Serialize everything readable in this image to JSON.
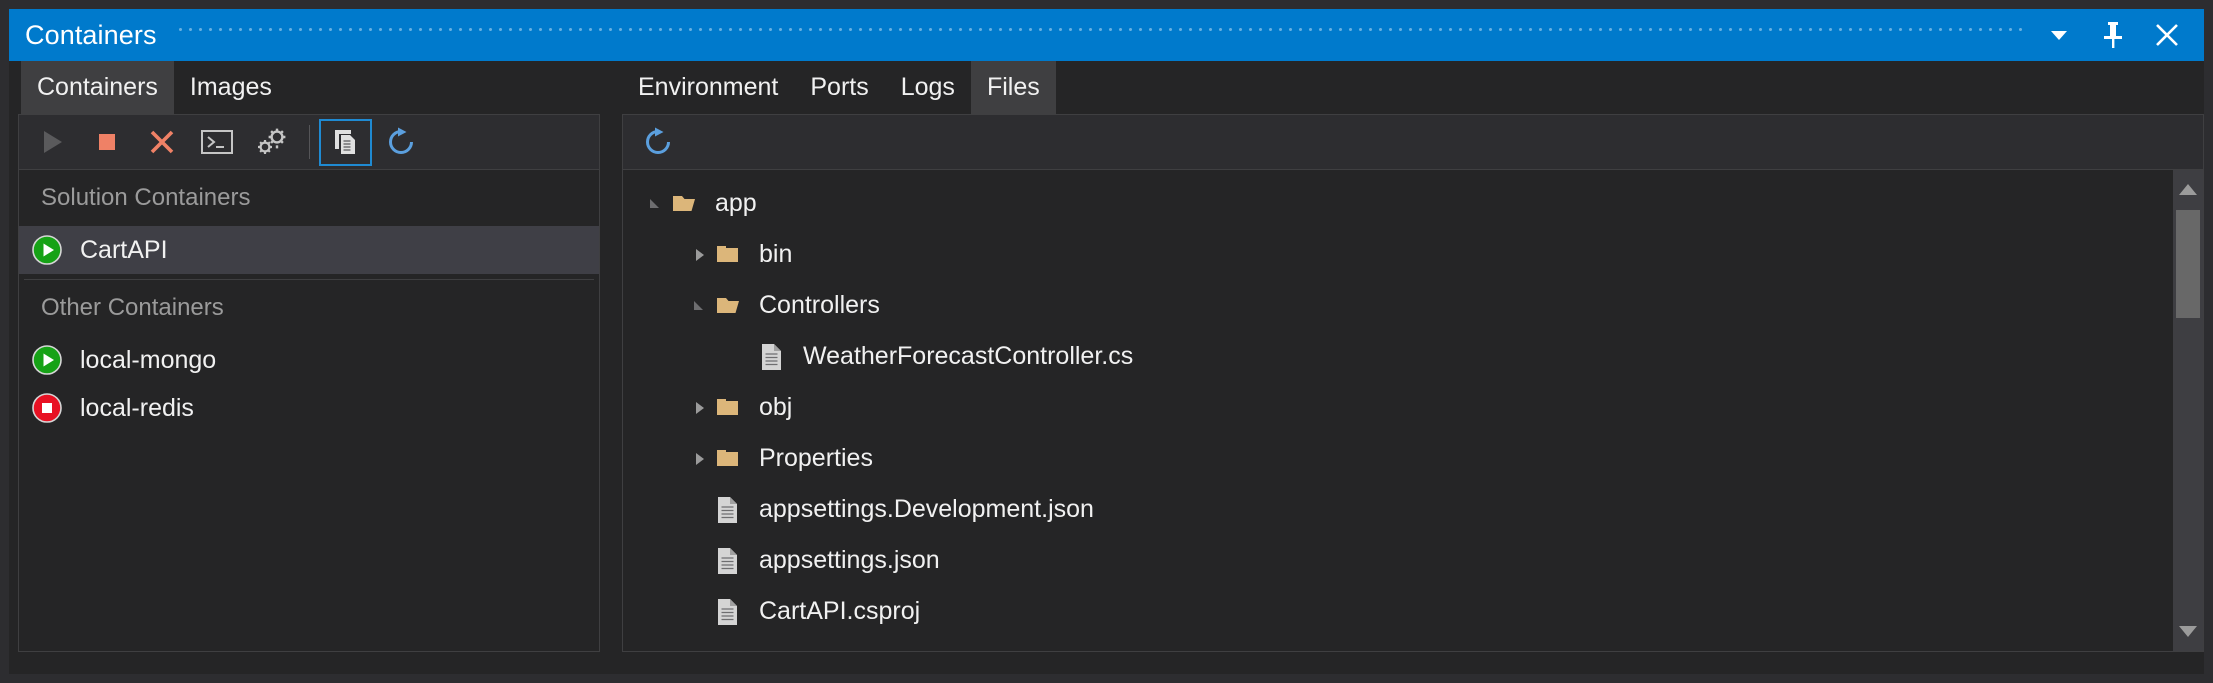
{
  "window": {
    "title": "Containers",
    "accent_color": "#007acc",
    "background_color": "#252526",
    "panel_color": "#2d2d30"
  },
  "titlebar_buttons": [
    {
      "name": "chevron-down-icon",
      "label": "Window options"
    },
    {
      "name": "pin-icon",
      "label": "Auto Hide"
    },
    {
      "name": "close-icon",
      "label": "Close"
    }
  ],
  "left_pane": {
    "tabs": [
      {
        "label": "Containers",
        "selected": true
      },
      {
        "label": "Images",
        "selected": false
      }
    ],
    "toolbar": [
      {
        "name": "play-button",
        "label": "Start",
        "icon": "play",
        "enabled": false,
        "active": false
      },
      {
        "name": "stop-button",
        "label": "Stop",
        "icon": "stop",
        "enabled": true,
        "active": false
      },
      {
        "name": "remove-button",
        "label": "Remove",
        "icon": "close-x",
        "enabled": true,
        "active": false
      },
      {
        "name": "terminal-button",
        "label": "Open Terminal Window",
        "icon": "terminal",
        "enabled": true,
        "active": false
      },
      {
        "name": "settings-button",
        "label": "Settings",
        "icon": "gears",
        "enabled": true,
        "active": false
      },
      {
        "name": "separator",
        "label": "",
        "icon": "separator",
        "enabled": true,
        "active": false
      },
      {
        "name": "files-button",
        "label": "Files",
        "icon": "files",
        "enabled": true,
        "active": true
      },
      {
        "name": "refresh-button",
        "label": "Refresh",
        "icon": "refresh",
        "enabled": true,
        "active": false
      }
    ],
    "groups": [
      {
        "header": "Solution Containers",
        "items": [
          {
            "name": "CartAPI",
            "state": "running",
            "selected": true
          }
        ]
      },
      {
        "header": "Other Containers",
        "items": [
          {
            "name": "local-mongo",
            "state": "running",
            "selected": false
          },
          {
            "name": "local-redis",
            "state": "stopped",
            "selected": false
          }
        ]
      }
    ],
    "status_colors": {
      "running": "#16a216",
      "stopped": "#e81123"
    }
  },
  "right_pane": {
    "tabs": [
      {
        "label": "Environment",
        "selected": false
      },
      {
        "label": "Ports",
        "selected": false
      },
      {
        "label": "Logs",
        "selected": false
      },
      {
        "label": "Files",
        "selected": true
      }
    ],
    "toolbar": [
      {
        "name": "refresh-button",
        "label": "Refresh",
        "icon": "refresh"
      }
    ],
    "tree": [
      {
        "label": "app",
        "type": "folder",
        "state": "expanded",
        "depth": 0
      },
      {
        "label": "bin",
        "type": "folder",
        "state": "collapsed",
        "depth": 1
      },
      {
        "label": "Controllers",
        "type": "folder",
        "state": "expanded",
        "depth": 1
      },
      {
        "label": "WeatherForecastController.cs",
        "type": "file",
        "state": "none",
        "depth": 2
      },
      {
        "label": "obj",
        "type": "folder",
        "state": "collapsed",
        "depth": 1
      },
      {
        "label": "Properties",
        "type": "folder",
        "state": "collapsed",
        "depth": 1
      },
      {
        "label": "appsettings.Development.json",
        "type": "file",
        "state": "none",
        "depth": 1
      },
      {
        "label": "appsettings.json",
        "type": "file",
        "state": "none",
        "depth": 1
      },
      {
        "label": "CartAPI.csproj",
        "type": "file",
        "state": "none",
        "depth": 1
      }
    ],
    "folder_color": "#dcb67a",
    "file_color": "#c5c5c5",
    "scrollbar": {
      "up_arrow": "scroll-up-arrow",
      "down_arrow": "scroll-down-arrow",
      "thumb_position_percent": 8
    }
  }
}
